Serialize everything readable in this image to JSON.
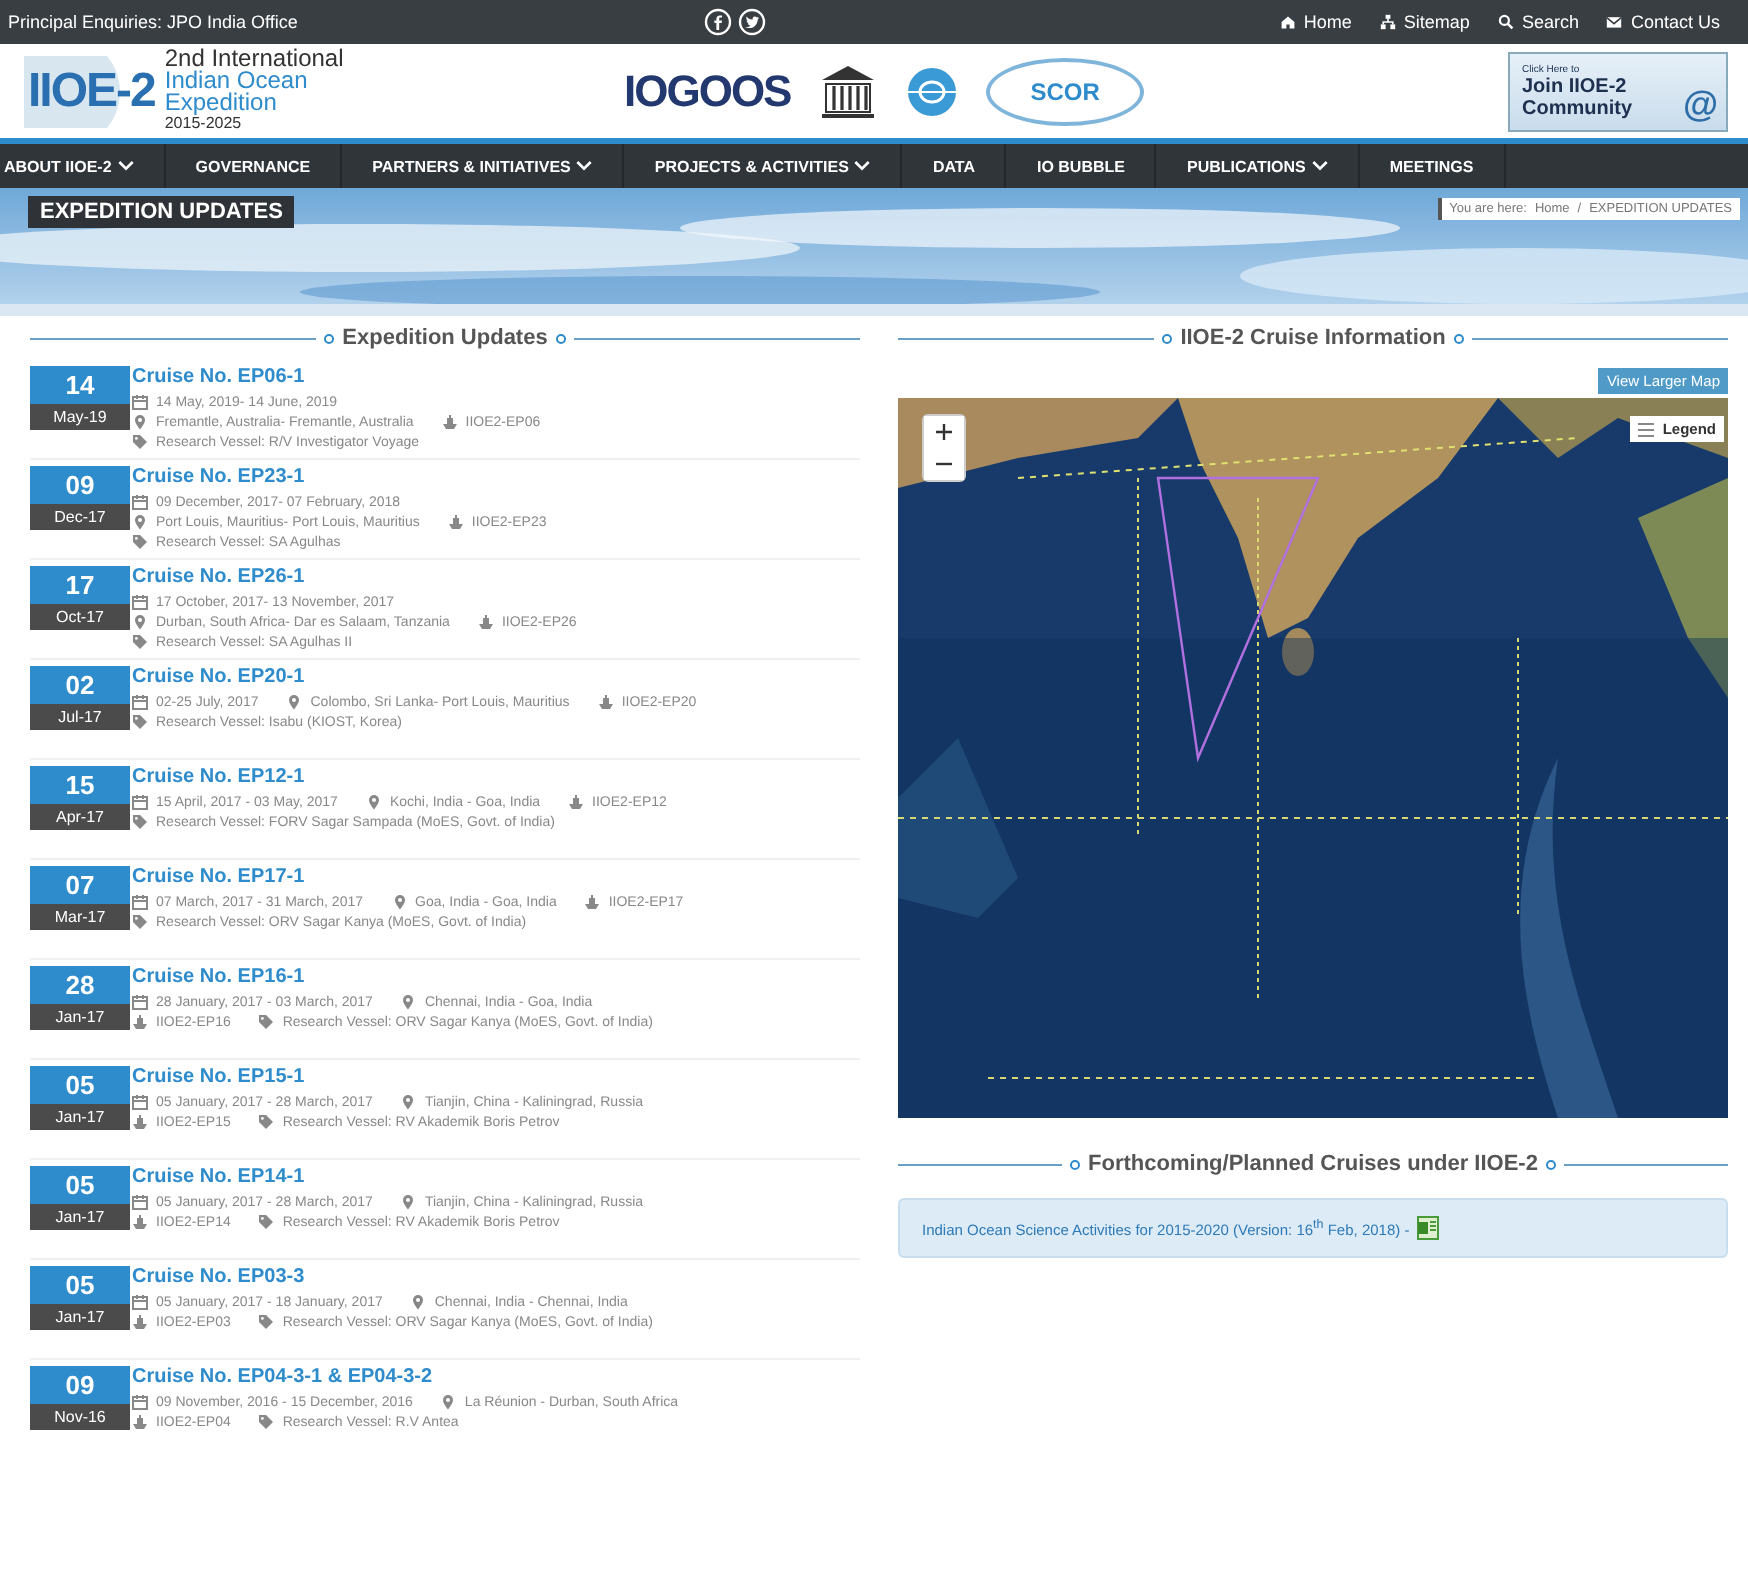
{
  "top_bar": {
    "enquiries": "Principal Enquiries: JPO India Office",
    "links": [
      {
        "kind": "home",
        "label": "Home"
      },
      {
        "kind": "sitemap",
        "label": "Sitemap"
      },
      {
        "kind": "search",
        "label": "Search"
      },
      {
        "kind": "contact",
        "label": "Contact Us"
      }
    ]
  },
  "header": {
    "logo": {
      "acronym": "IIOE-2",
      "lines": [
        "2nd International",
        "Indian Ocean",
        "Expedition"
      ],
      "years": "2015-2025"
    },
    "partners": {
      "iogoos": "IOGOOS",
      "scor": "SCOR"
    },
    "join": {
      "small": "Click Here to",
      "text": "Join IIOE-2 Community",
      "at": "@"
    }
  },
  "nav": [
    {
      "label": "ABOUT IIOE-2",
      "dropdown": true
    },
    {
      "label": "GOVERNANCE",
      "dropdown": false
    },
    {
      "label": "PARTNERS & INITIATIVES",
      "dropdown": true
    },
    {
      "label": "PROJECTS & ACTIVITIES",
      "dropdown": true
    },
    {
      "label": "DATA",
      "dropdown": false
    },
    {
      "label": "IO BUBBLE",
      "dropdown": false
    },
    {
      "label": "PUBLICATIONS",
      "dropdown": true
    },
    {
      "label": "MEETINGS",
      "dropdown": false
    }
  ],
  "banner": {
    "title": "EXPEDITION UPDATES",
    "breadcrumb": {
      "prefix": "You are here:",
      "home": "Home",
      "separator": "/",
      "current": "EXPEDITION UPDATES"
    }
  },
  "updates": {
    "heading": "Expedition Updates",
    "entries": [
      {
        "day": "14",
        "month": "May-19",
        "title": "Cruise No. EP06-1",
        "lines": [
          [
            {
              "kind": "date",
              "text": "14 May, 2019- 14 June, 2019"
            }
          ],
          [
            {
              "kind": "place",
              "text": "Fremantle, Australia- Fremantle, Australia"
            },
            {
              "kind": "ship",
              "text": "IIOE2-EP06"
            }
          ],
          [
            {
              "kind": "vessel",
              "text": "Research Vessel: R/V Investigator Voyage"
            }
          ]
        ]
      },
      {
        "day": "09",
        "month": "Dec-17",
        "title": "Cruise No. EP23-1",
        "lines": [
          [
            {
              "kind": "date",
              "text": "09 December, 2017- 07 February, 2018"
            }
          ],
          [
            {
              "kind": "place",
              "text": "Port Louis, Mauritius- Port Louis, Mauritius"
            },
            {
              "kind": "ship",
              "text": "IIOE2-EP23"
            }
          ],
          [
            {
              "kind": "vessel",
              "text": "Research Vessel: SA Agulhas"
            }
          ]
        ]
      },
      {
        "day": "17",
        "month": "Oct-17",
        "title": "Cruise No. EP26-1",
        "lines": [
          [
            {
              "kind": "date",
              "text": "17 October, 2017- 13 November, 2017"
            }
          ],
          [
            {
              "kind": "place",
              "text": "Durban, South Africa- Dar es Salaam, Tanzania"
            },
            {
              "kind": "ship",
              "text": "IIOE2-EP26"
            }
          ],
          [
            {
              "kind": "vessel",
              "text": "Research Vessel: SA Agulhas II"
            }
          ]
        ]
      },
      {
        "day": "02",
        "month": "Jul-17",
        "title": "Cruise No. EP20-1",
        "lines": [
          [
            {
              "kind": "date",
              "text": "02-25 July, 2017"
            },
            {
              "kind": "place",
              "text": "Colombo, Sri Lanka- Port Louis, Mauritius"
            },
            {
              "kind": "ship",
              "text": "IIOE2-EP20"
            }
          ],
          [
            {
              "kind": "vessel",
              "text": "Research Vessel: Isabu (KIOST, Korea)"
            }
          ]
        ]
      },
      {
        "day": "15",
        "month": "Apr-17",
        "title": "Cruise No. EP12-1",
        "lines": [
          [
            {
              "kind": "date",
              "text": "15 April, 2017 - 03 May, 2017"
            },
            {
              "kind": "place",
              "text": "Kochi, India - Goa, India"
            },
            {
              "kind": "ship",
              "text": "IIOE2-EP12"
            }
          ],
          [
            {
              "kind": "vessel",
              "text": "Research Vessel: FORV Sagar Sampada (MoES, Govt. of India)"
            }
          ]
        ]
      },
      {
        "day": "07",
        "month": "Mar-17",
        "title": "Cruise No. EP17-1",
        "lines": [
          [
            {
              "kind": "date",
              "text": "07 March, 2017 - 31 March, 2017"
            },
            {
              "kind": "place",
              "text": "Goa, India - Goa, India"
            },
            {
              "kind": "ship",
              "text": "IIOE2-EP17"
            }
          ],
          [
            {
              "kind": "vessel",
              "text": "Research Vessel: ORV Sagar Kanya (MoES, Govt. of India)"
            }
          ]
        ]
      },
      {
        "day": "28",
        "month": "Jan-17",
        "title": "Cruise No. EP16-1",
        "lines": [
          [
            {
              "kind": "date",
              "text": "28 January, 2017 - 03 March, 2017"
            },
            {
              "kind": "place",
              "text": "Chennai, India - Goa, India"
            }
          ],
          [
            {
              "kind": "ship",
              "text": "IIOE2-EP16"
            },
            {
              "kind": "vessel",
              "text": "Research Vessel: ORV Sagar Kanya (MoES, Govt. of India)"
            }
          ]
        ]
      },
      {
        "day": "05",
        "month": "Jan-17",
        "title": "Cruise No. EP15-1",
        "lines": [
          [
            {
              "kind": "date",
              "text": "05 January, 2017 - 28 March, 2017"
            },
            {
              "kind": "place",
              "text": "Tianjin, China - Kaliningrad, Russia"
            }
          ],
          [
            {
              "kind": "ship",
              "text": "IIOE2-EP15"
            },
            {
              "kind": "vessel",
              "text": "Research Vessel: RV Akademik Boris Petrov"
            }
          ]
        ]
      },
      {
        "day": "05",
        "month": "Jan-17",
        "title": "Cruise No. EP14-1",
        "lines": [
          [
            {
              "kind": "date",
              "text": "05 January, 2017 - 28 March, 2017"
            },
            {
              "kind": "place",
              "text": "Tianjin, China - Kaliningrad, Russia"
            }
          ],
          [
            {
              "kind": "ship",
              "text": "IIOE2-EP14"
            },
            {
              "kind": "vessel",
              "text": "Research Vessel: RV Akademik Boris Petrov"
            }
          ]
        ]
      },
      {
        "day": "05",
        "month": "Jan-17",
        "title": "Cruise No. EP03-3",
        "lines": [
          [
            {
              "kind": "date",
              "text": "05 January, 2017 - 18 January, 2017"
            },
            {
              "kind": "place",
              "text": "Chennai, India - Chennai, India"
            }
          ],
          [
            {
              "kind": "ship",
              "text": "IIOE2-EP03"
            },
            {
              "kind": "vessel",
              "text": "Research Vessel: ORV Sagar Kanya (MoES, Govt. of India)"
            }
          ]
        ]
      },
      {
        "day": "09",
        "month": "Nov-16",
        "title": "Cruise No. EP04-3-1 & EP04-3-2",
        "lines": [
          [
            {
              "kind": "date",
              "text": "09 November, 2016 - 15 December, 2016"
            },
            {
              "kind": "place",
              "text": "La Réunion - Durban, South Africa"
            }
          ],
          [
            {
              "kind": "ship",
              "text": "IIOE2-EP04"
            },
            {
              "kind": "vessel",
              "text": "Research Vessel: R.V Antea"
            }
          ]
        ]
      }
    ]
  },
  "cruise_info": {
    "heading": "IIOE-2 Cruise Information",
    "map_button": "View Larger Map",
    "legend": "Legend"
  },
  "forthcoming": {
    "heading": "Forthcoming/Planned Cruises under IIOE-2",
    "items": [
      "Indian Ocean Science Activities for 2015-2020 (Version: 16$^{th}$ Feb, 2018) -"
    ]
  }
}
